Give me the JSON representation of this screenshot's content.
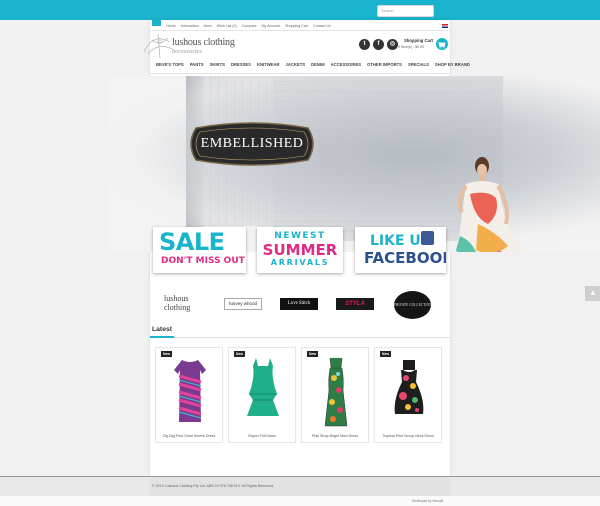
{
  "header": {
    "search_placeholder": "Search",
    "toplinks": [
      "Home",
      "Information",
      "More",
      "Wish List (0)",
      "Compare",
      "My Account",
      "Shopping Cart",
      "Contact Us"
    ],
    "cart_title": "Shopping Cart",
    "cart_summary": "0 item(s) - $0.00",
    "accent_color": "#1ab3cd"
  },
  "logo": {
    "title": "lushous clothing",
    "subtitle": "accessories"
  },
  "social": [
    {
      "icon": "twitter-icon",
      "glyph": "t"
    },
    {
      "icon": "facebook-icon",
      "glyph": "f"
    },
    {
      "icon": "instagram-icon",
      "glyph": "◎"
    }
  ],
  "nav": [
    "BEVE'S TOPS",
    "PANTS",
    "SKIRTS",
    "DRESSES",
    "KNITWEAR",
    "JACKETS",
    "DENIM",
    "ACCESSORIES",
    "OTHER IMPORTS",
    "SPECIALS",
    "SHOP BY BRAND"
  ],
  "hero": {
    "badge_text": "EMBELLISHED"
  },
  "promos": {
    "sale": {
      "big": "SALE",
      "small": "DON'T MISS OUT!"
    },
    "newest": {
      "line1": "NEWEST",
      "line2": "SUMMER",
      "line3": "ARRIVALS"
    },
    "facebook": {
      "line1": "LIKE US",
      "line2": "FACEBOOK"
    }
  },
  "brands": {
    "lushous": "lushous clothing",
    "harvey": "harvey whood",
    "lovestitch": "Love Stitch",
    "styla": "STYLA",
    "round": "PRIVATE COLLECTION"
  },
  "latest": {
    "heading": "Latest",
    "products": [
      {
        "badge": "New",
        "name": "Zig Zag Print Short Sleeve Dress"
      },
      {
        "badge": "New",
        "name": "Rayon Frill Dress"
      },
      {
        "badge": "New",
        "name": "Plait Strap Bright Maxi Dress"
      },
      {
        "badge": "New",
        "name": "Tropical Print Scoop Neck Dress"
      }
    ]
  },
  "footer": {
    "copyright": "© 2013 Lushous Clothing Pty Ltd. ABN 24 576 758 914. All Rights Reserved.",
    "developed_by": "Developed by Nexus8"
  }
}
